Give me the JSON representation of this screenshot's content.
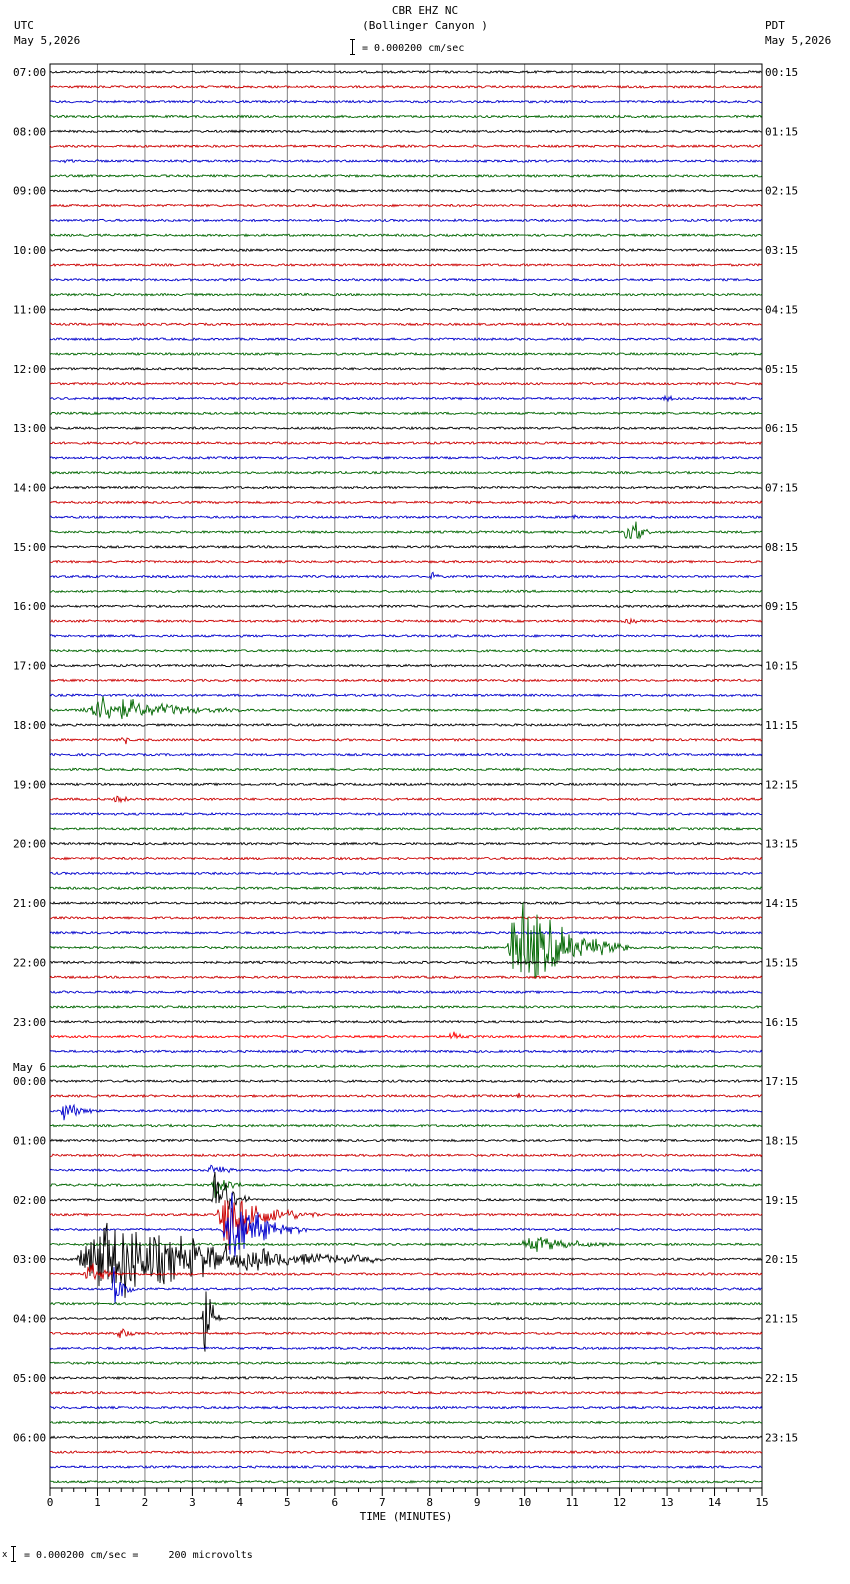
{
  "header": {
    "station": "CBR EHZ NC",
    "site": "(Bollinger Canyon )",
    "scale": "= 0.000200 cm/sec",
    "left_tz": "UTC",
    "left_date": "May 5,2026",
    "right_tz": "PDT",
    "right_date": "May 5,2026"
  },
  "footer": {
    "scale_mark": "x",
    "scale_text": "= 0.000200 cm/sec =     200 microvolts"
  },
  "colors": {
    "trace_cycle": [
      "#000000",
      "#cc0000",
      "#0000cc",
      "#006600"
    ],
    "grid": "#808080",
    "frame": "#000000",
    "event_red": "#ff0000"
  },
  "chart_data": {
    "type": "line",
    "title": "CBR EHZ NC (Bollinger Canyon )",
    "xlabel": "TIME (MINUTES)",
    "xlim": [
      0,
      15
    ],
    "x_ticks": [
      "0",
      "1",
      "2",
      "3",
      "4",
      "5",
      "6",
      "7",
      "8",
      "9",
      "10",
      "11",
      "12",
      "13",
      "14",
      "15"
    ],
    "left_labels": [
      "07:00",
      "08:00",
      "09:00",
      "10:00",
      "11:00",
      "12:00",
      "13:00",
      "14:00",
      "15:00",
      "16:00",
      "17:00",
      "18:00",
      "19:00",
      "20:00",
      "21:00",
      "22:00",
      "23:00",
      "00:00",
      "01:00",
      "02:00",
      "03:00",
      "04:00",
      "05:00",
      "06:00"
    ],
    "date_change_label": "May 6",
    "right_labels": [
      "00:15",
      "01:15",
      "02:15",
      "03:15",
      "04:15",
      "05:15",
      "06:15",
      "07:15",
      "08:15",
      "09:15",
      "10:15",
      "11:15",
      "12:15",
      "13:15",
      "14:15",
      "15:15",
      "16:15",
      "17:15",
      "18:15",
      "19:15",
      "20:15",
      "21:15",
      "22:15",
      "23:15"
    ],
    "traces_per_hour": 4,
    "trace_count": 96,
    "events": [
      {
        "trace": 6,
        "minute": 0.3,
        "duration": 0.4,
        "amp": 5
      },
      {
        "trace": 22,
        "minute": 12.9,
        "duration": 0.6,
        "amp": 5
      },
      {
        "trace": 30,
        "minute": 11.0,
        "duration": 0.3,
        "amp": 5
      },
      {
        "trace": 31,
        "minute": 12.1,
        "duration": 0.6,
        "amp": 20
      },
      {
        "trace": 34,
        "minute": 8.0,
        "duration": 0.4,
        "amp": 5
      },
      {
        "trace": 37,
        "minute": 12.1,
        "duration": 0.5,
        "amp": 5
      },
      {
        "trace": 43,
        "minute": 0.6,
        "duration": 3.8,
        "amp": 16
      },
      {
        "trace": 45,
        "minute": 1.5,
        "duration": 0.5,
        "amp": 6
      },
      {
        "trace": 49,
        "minute": 1.3,
        "duration": 0.8,
        "amp": 5
      },
      {
        "trace": 59,
        "minute": 9.6,
        "duration": 2.6,
        "amp": 50
      },
      {
        "trace": 65,
        "minute": 8.4,
        "duration": 0.5,
        "amp": 9
      },
      {
        "trace": 69,
        "minute": 9.8,
        "duration": 0.5,
        "amp": 5
      },
      {
        "trace": 70,
        "minute": 0.2,
        "duration": 1.0,
        "amp": 10
      },
      {
        "trace": 74,
        "minute": 3.3,
        "duration": 1.0,
        "amp": 6
      },
      {
        "trace": 75,
        "minute": 3.4,
        "duration": 0.9,
        "amp": 14
      },
      {
        "trace": 76,
        "minute": 3.4,
        "duration": 0.8,
        "amp": 35
      },
      {
        "trace": 77,
        "minute": 3.5,
        "duration": 2.2,
        "amp": 30
      },
      {
        "trace": 78,
        "minute": 3.6,
        "duration": 1.8,
        "amp": 35
      },
      {
        "trace": 79,
        "minute": 9.8,
        "duration": 3.0,
        "amp": 8
      },
      {
        "trace": 80,
        "minute": 0.5,
        "duration": 6.5,
        "amp": 40
      },
      {
        "trace": 81,
        "minute": 0.7,
        "duration": 1.0,
        "amp": 12
      },
      {
        "trace": 82,
        "minute": 1.3,
        "duration": 0.5,
        "amp": 25
      },
      {
        "trace": 84,
        "minute": 3.2,
        "duration": 0.4,
        "amp": 45
      },
      {
        "trace": 85,
        "minute": 1.4,
        "duration": 0.6,
        "amp": 10
      }
    ]
  }
}
